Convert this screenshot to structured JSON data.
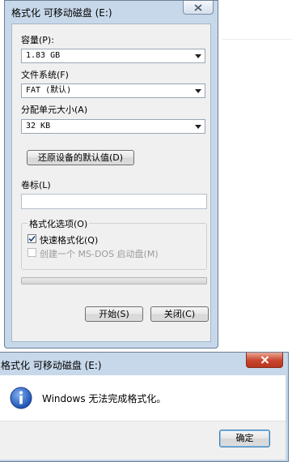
{
  "format_dialog": {
    "title": "格式化 可移动磁盘 (E:)",
    "capacity_label": "容量(P):",
    "capacity_value": "1.83 GB",
    "filesystem_label": "文件系统(F)",
    "filesystem_value": "FAT (默认)",
    "allocation_label": "分配单元大小(A)",
    "allocation_value": "32 KB",
    "restore_defaults_button": "还原设备的默认值(D)",
    "volume_label_label": "卷标(L)",
    "volume_label_value": "",
    "options_group_title": "格式化选项(O)",
    "quick_format_label": "快速格式化(Q)",
    "quick_format_checked": true,
    "msdos_boot_label": "创建一个 MS-DOS 启动盘(M)",
    "msdos_boot_checked": false,
    "progress": 0,
    "start_button": "开始(S)",
    "close_button": "关闭(C)"
  },
  "message_box": {
    "title": "格式化 可移动磁盘 (E:)",
    "message": "Windows 无法完成格式化。",
    "ok_button": "确定",
    "icon": "info-icon"
  },
  "colors": {
    "window_frame": "#c7d8ea",
    "dialog_face": "#f0f0f0",
    "close_red": "#c9452d",
    "info_blue": "#2a63c9"
  }
}
